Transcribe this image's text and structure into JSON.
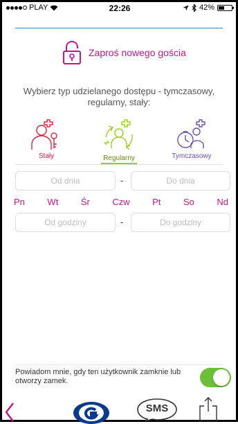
{
  "status_bar": {
    "carrier": "PLAY",
    "time": "22:26",
    "battery": "42%",
    "battery_level": 0.42
  },
  "header": {
    "title": "Zaproś nowego gościa"
  },
  "instruction": {
    "text": "Wybierz typ udzielanego dostępu - tymczasowy, regularny, stały:"
  },
  "access_types": [
    {
      "label": "Stały"
    },
    {
      "label": "Regularny",
      "selected": true
    },
    {
      "label": "Tymczasowy"
    }
  ],
  "date_range": {
    "from_placeholder": "Od dnia",
    "to_placeholder": "Do dnia",
    "separator": "-"
  },
  "days": [
    "Pn",
    "Wt",
    "Śr",
    "Czw",
    "Pt",
    "So",
    "Nd"
  ],
  "time_range": {
    "from_placeholder": "Od godziny",
    "to_placeholder": "Do godziny",
    "separator": "-"
  },
  "notify": {
    "text": "Powiadom mnie, gdy ten użytkownik zamknie lub otworzy zamek.",
    "enabled": true
  },
  "toolbar": {
    "sms_label": "SMS"
  },
  "colors": {
    "accent": "#c0168c",
    "staly": "#e02040",
    "regularny": "#9ad020",
    "tymczasowy": "#6b4fb0",
    "toggle_on": "#6dbf3a"
  }
}
